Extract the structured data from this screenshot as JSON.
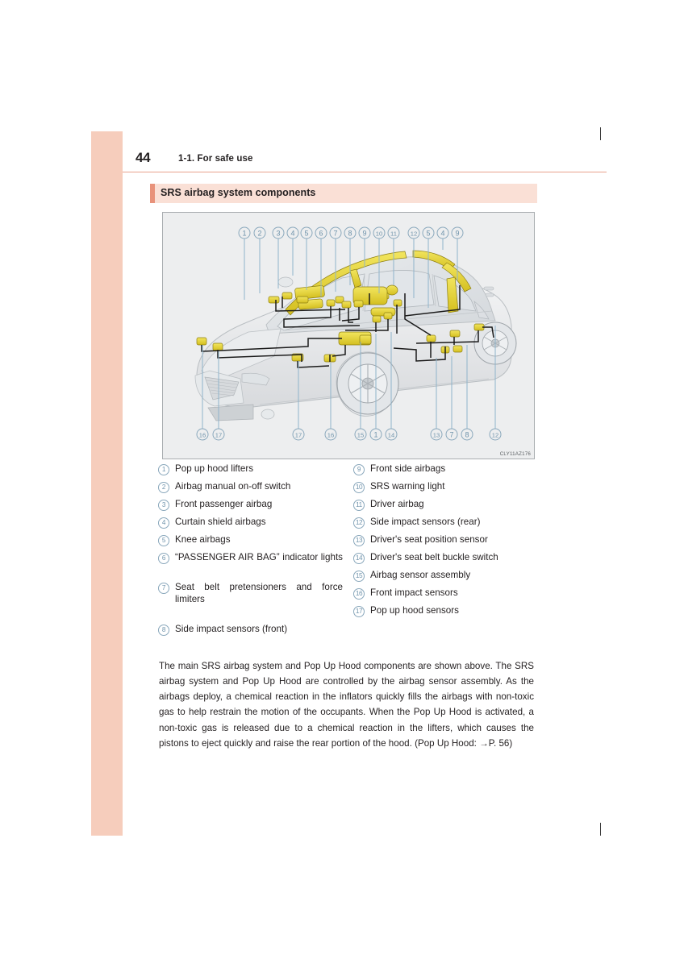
{
  "page": {
    "folio": "44",
    "running_head": "1-1. For safe use"
  },
  "section": {
    "title": "SRS airbag system components"
  },
  "figure": {
    "caption_code": "CLY11AZ176",
    "background_color": "#edeeef",
    "callout_color": "#7aa3bd",
    "part_color": "#e8d84a",
    "top_callouts": [
      "1",
      "2",
      "3",
      "4",
      "5",
      "6",
      "7",
      "8",
      "9",
      "10",
      "11",
      "12",
      "5",
      "4",
      "9"
    ],
    "bottom_callouts": [
      "16",
      "17",
      "17",
      "16",
      "15",
      "1",
      "14",
      "13",
      "7",
      "8",
      "12"
    ],
    "alt": "Cutaway illustration of a Lexus sedan showing SRS airbag and Pop Up Hood component locations"
  },
  "legend": {
    "left_column": [
      {
        "num": "1",
        "label": "Pop up hood lifters"
      },
      {
        "num": "2",
        "label": "Airbag manual on-off switch"
      },
      {
        "num": "3",
        "label": "Front passenger airbag"
      },
      {
        "num": "4",
        "label": "Curtain shield airbags"
      },
      {
        "num": "5",
        "label": "Knee airbags"
      },
      {
        "num": "6",
        "label": "“PASSENGER AIR BAG” indicator lights"
      },
      {
        "num": "7",
        "label": "Seat belt pretensioners and force limiters"
      },
      {
        "num": "8",
        "label": "Side impact sensors (front)"
      }
    ],
    "right_column": [
      {
        "num": "9",
        "label": "Front side airbags"
      },
      {
        "num": "10",
        "label": "SRS warning light"
      },
      {
        "num": "11",
        "label": "Driver airbag"
      },
      {
        "num": "12",
        "label": "Side impact sensors (rear)"
      },
      {
        "num": "13",
        "label": "Driver's seat position sensor"
      },
      {
        "num": "14",
        "label": "Driver's seat belt buckle switch"
      },
      {
        "num": "15",
        "label": "Airbag sensor assembly"
      },
      {
        "num": "16",
        "label": "Front impact sensors"
      },
      {
        "num": "17",
        "label": "Pop up hood sensors"
      }
    ]
  },
  "body": {
    "paragraph": "The main SRS airbag system and Pop Up Hood components are shown above. The SRS airbag system and Pop Up Hood are controlled by the airbag sensor assembly. As the airbags deploy, a chemical reaction in the inflators quickly fills the airbags with non-toxic gas to help restrain the motion of the occupants. When the Pop Up Hood is activated, a non-toxic gas is released due to a chemical reaction in the lifters, which causes the pistons to eject quickly and raise the rear portion of the hood. (Pop Up Hood: →P. 56)"
  },
  "theme": {
    "tab_color": "#f6cdbc",
    "rule_color": "#e8a18c",
    "section_bg": "#fae0d6",
    "section_accent": "#e8927a",
    "text_color": "#231f20"
  }
}
